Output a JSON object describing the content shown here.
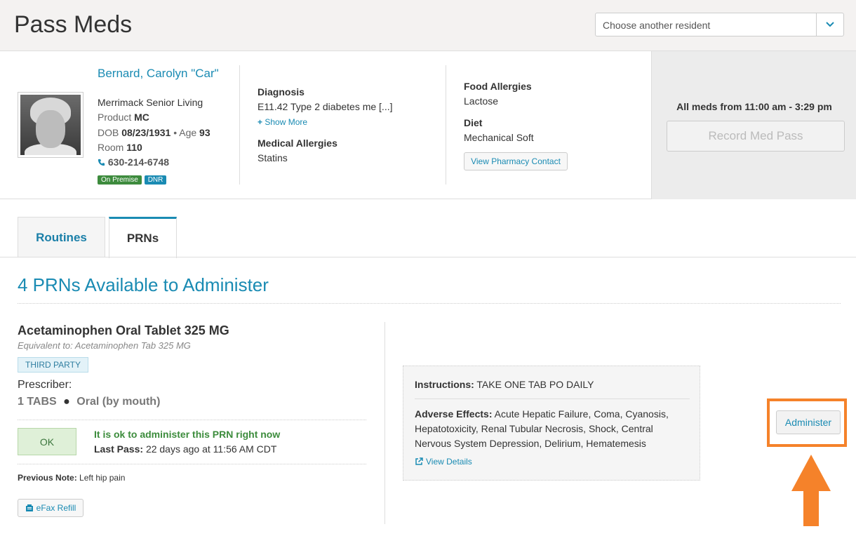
{
  "header": {
    "title": "Pass Meds",
    "resident_select_placeholder": "Choose another resident"
  },
  "resident": {
    "name": "Bernard, Carolyn \"Car\"",
    "facility": "Merrimack Senior Living",
    "product_label": "Product",
    "product_value": "MC",
    "dob_label": "DOB",
    "dob_value": "08/23/1931",
    "bullet": "•",
    "age_label": "Age",
    "age_value": "93",
    "room_label": "Room",
    "room_value": "110",
    "phone": "630-214-6748",
    "badge_on_premise": "On Premise",
    "badge_dnr": "DNR"
  },
  "clinical": {
    "diagnosis_label": "Diagnosis",
    "diagnosis_value": "E11.42 Type 2 diabetes me [...]",
    "show_more": "Show More",
    "med_allergies_label": "Medical Allergies",
    "med_allergies_value": "Statins",
    "food_allergies_label": "Food Allergies",
    "food_allergies_value": "Lactose",
    "diet_label": "Diet",
    "diet_value": "Mechanical Soft",
    "pharmacy_button": "View Pharmacy Contact"
  },
  "med_pass": {
    "all_meds_text": "All meds from 11:00 am - 3:29 pm",
    "record_button": "Record Med Pass"
  },
  "tabs": [
    {
      "label": "Routines",
      "active": false
    },
    {
      "label": "PRNs",
      "active": true
    }
  ],
  "prn": {
    "heading": "4 PRNs Available to Administer",
    "med_name": "Acetaminophen Oral Tablet 325 MG",
    "equivalent": "Equivalent to: Acetaminophen Tab 325 MG",
    "tag": "THIRD PARTY",
    "prescriber_label": "Prescriber:",
    "dose": "1 TABS",
    "route": "Oral (by mouth)",
    "ok_label": "OK",
    "ok_message": "It is ok to administer this PRN right now",
    "last_pass_label": "Last Pass:",
    "last_pass_value": "22 days ago at 11:56 AM CDT",
    "prev_note_label": "Previous Note:",
    "prev_note_value": "Left hip pain",
    "efax_button": "eFax Refill",
    "instructions_label": "Instructions:",
    "instructions_value": "TAKE ONE TAB PO DAILY",
    "adverse_label": "Adverse Effects:",
    "adverse_value": "Acute Hepatic Failure, Coma, Cyanosis, Hepatotoxicity, Renal Tubular Necrosis, Shock, Central Nervous System Depression, Delirium, Hematemesis",
    "view_details": "View Details",
    "administer_button": "Administer"
  },
  "colors": {
    "accent": "#1a8bb3",
    "highlight": "#f5822a",
    "ok_green": "#3c8c3c"
  }
}
